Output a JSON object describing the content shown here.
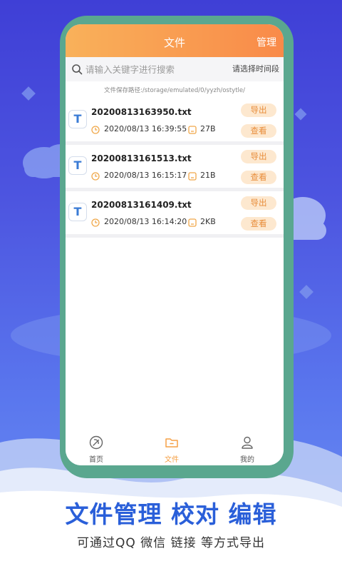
{
  "header": {
    "title": "文件",
    "action": "管理"
  },
  "search": {
    "placeholder": "请输入关键字进行搜索",
    "time_filter": "请选择时间段"
  },
  "path_text": "文件保存路径:/storage/emulated/0/yyzh/ostytle/",
  "files": [
    {
      "name": "20200813163950.txt",
      "date": "2020/08/13 16:39:55",
      "size": "27B",
      "export_label": "导出",
      "view_label": "查看"
    },
    {
      "name": "20200813161513.txt",
      "date": "2020/08/13 16:15:17",
      "size": "21B",
      "export_label": "导出",
      "view_label": "查看"
    },
    {
      "name": "20200813161409.txt",
      "date": "2020/08/13 16:14:20",
      "size": "2KB",
      "export_label": "导出",
      "view_label": "查看"
    }
  ],
  "file_icon_letter": "T",
  "nav": [
    {
      "label": "首页",
      "icon": "home-icon",
      "active": false
    },
    {
      "label": "文件",
      "icon": "folder-icon",
      "active": true
    },
    {
      "label": "我的",
      "icon": "person-icon",
      "active": false
    }
  ],
  "caption": {
    "main": "文件管理 校对 编辑",
    "sub": "可通过QQ 微信 链接 等方式导出"
  },
  "colors": {
    "accent": "#f98a49",
    "accent_light": "#f9b15a",
    "button_bg": "#fde8cf",
    "button_text": "#e88d3a",
    "caption_blue": "#2a5fd9",
    "phone_frame": "#5aa78f"
  }
}
